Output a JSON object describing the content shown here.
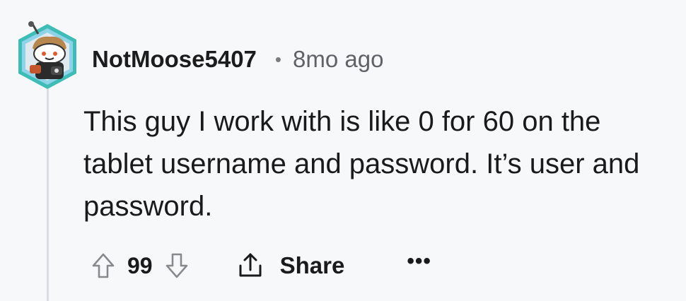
{
  "comment": {
    "author": "NotMoose5407",
    "separator": "•",
    "timestamp": "8mo ago",
    "body": "This guy I work with is like 0 for 60 on the tablet username and password. It’s user and password.",
    "score": "99",
    "share_label": "Share",
    "more_label": "•••"
  },
  "icons": {
    "avatar": "snoo-avatar-icon",
    "upvote": "arrow-up-icon",
    "downvote": "arrow-down-icon",
    "share": "share-icon",
    "more": "more-options-icon"
  },
  "colors": {
    "background": "#f7f8fa",
    "thread_line": "#d7dde3",
    "vote_arrow": "#878a8c",
    "text": "#1a1a1b",
    "meta": "#5f6368"
  }
}
